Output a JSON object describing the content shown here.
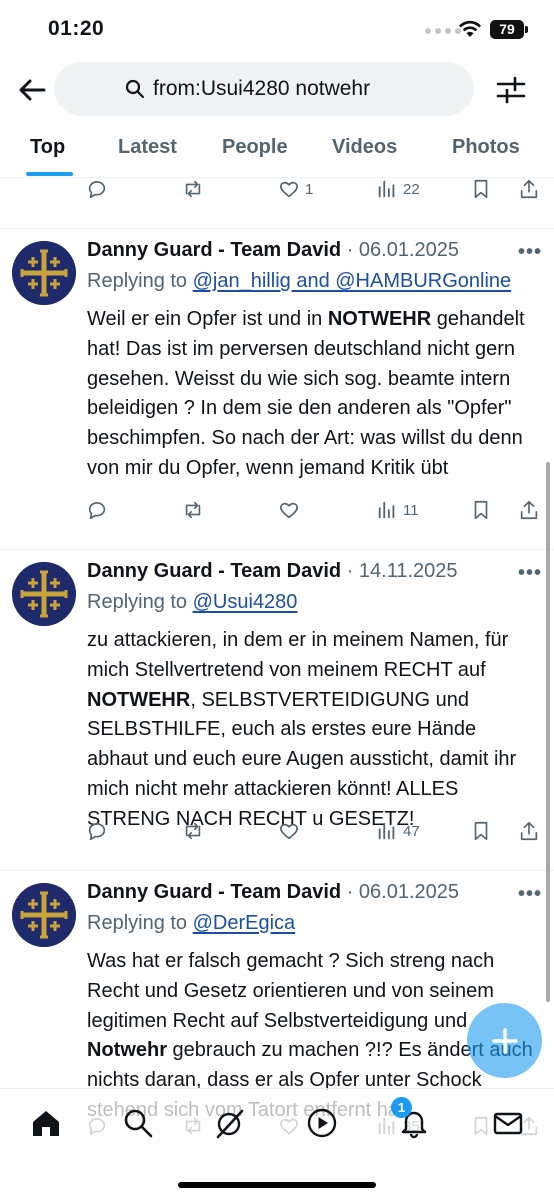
{
  "status_bar": {
    "time": "01:20",
    "battery": "79"
  },
  "search": {
    "query": "from:Usui4280 notwehr"
  },
  "tabs": [
    "Top",
    "Latest",
    "People",
    "Videos",
    "Photos"
  ],
  "active_tab": "Top",
  "top_actions": {
    "likes": "1",
    "views": "22"
  },
  "tweets": [
    {
      "author": "Danny Guard - Team David",
      "date": "· 06.01.2025",
      "replying_prefix": "Replying to ",
      "replying_to": "@jan_hillig and @HAMBURGonline",
      "body_parts": [
        "Weil er ein Opfer ist und in ",
        "NOTWEHR",
        " gehandelt hat! Das ist im perversen deutschland nicht gern gesehen. Weisst du wie sich sog. beamte intern beleidigen ? In dem sie den anderen als \"Opfer\" beschimpfen. So nach der Art: was willst du denn von mir du Opfer, wenn jemand Kritik übt"
      ],
      "likes": "",
      "views": "11"
    },
    {
      "author": "Danny Guard - Team David",
      "date": "· 14.11.2025",
      "replying_prefix": "Replying to ",
      "replying_to": "@Usui4280",
      "body_parts": [
        "zu attackieren, in dem er in meinem Namen, für mich Stellvertretend von meinem RECHT auf ",
        "NOTWEHR",
        ", SELBSTVERTEIDIGUNG und SELBSTHILFE, euch als erstes eure Hände abhaut und euch eure Augen aussticht, damit ihr mich nicht mehr attackieren könnt! ALLES STRENG NACH RECHT u GESETZ!"
      ],
      "likes": "",
      "views": "47"
    },
    {
      "author": "Danny Guard - Team David",
      "date": "· 06.01.2025",
      "replying_prefix": "Replying to ",
      "replying_to": "@DerEgica",
      "body_parts": [
        "Was hat er falsch gemacht ? Sich streng nach Recht und Gesetz orientieren und von seinem legitimen Recht auf Selbstverteidigung und ",
        "Notwehr",
        " gebrauch zu machen ?!? Es ändert auch nichts daran, dass er als Opfer unter Schock stehend sich vom Tatort entfernt hat."
      ],
      "likes": "",
      "views": "35"
    }
  ],
  "bottom_nav": {
    "items": [
      "home-icon",
      "search-icon",
      "grok-icon",
      "play-icon",
      "bell-icon",
      "mail-icon"
    ],
    "notification_badge": "1"
  },
  "colors": {
    "accent": "#1d9bf0",
    "secondary_text": "#536471",
    "link": "#1d4fa0",
    "avatar_bg": "#1f2a6b",
    "cross_gold": "#c8a43a"
  }
}
